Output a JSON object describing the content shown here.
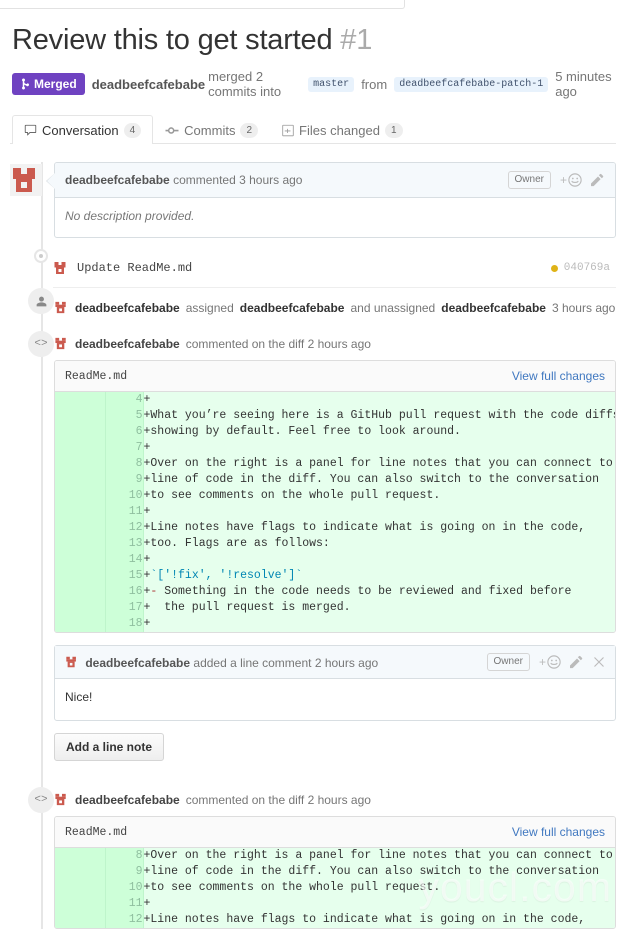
{
  "pull_request": {
    "title": "Review this to get started",
    "number": "#1",
    "state_label": "Merged",
    "meta": {
      "author": "deadbeefcafebabe",
      "merged_text": "merged 2 commits into",
      "base_branch": "master",
      "from_text": "from",
      "head_branch": "deadbeefcafebabe-patch-1",
      "time": "5 minutes ago"
    }
  },
  "tabs": [
    {
      "label": "Conversation",
      "count": "4",
      "icon": "comment-icon",
      "active": true
    },
    {
      "label": "Commits",
      "count": "2",
      "icon": "commit-icon",
      "active": false
    },
    {
      "label": "Files changed",
      "count": "1",
      "icon": "file-diff-icon",
      "active": false
    }
  ],
  "timeline": {
    "main_comment": {
      "author": "deadbeefcafebabe",
      "action": "commented 3 hours ago",
      "owner_badge": "Owner",
      "body": "No description provided."
    },
    "commit": {
      "message": "Update ReadMe.md",
      "sha": "040769a"
    },
    "assign_event": {
      "actor": "deadbeefcafebabe",
      "assigned_text": "assigned",
      "assignee": "deadbeefcafebabe",
      "unassigned_text": "and unassigned",
      "unassignee": "deadbeefcafebabe",
      "time": "3 hours ago"
    },
    "diff_comment_1": {
      "author": "deadbeefcafebabe",
      "action": "commented on the diff 2 hours ago",
      "file": "ReadMe.md",
      "view_full_changes": "View full changes",
      "lines": [
        {
          "num": "4",
          "text": "+"
        },
        {
          "num": "5",
          "text": "+What you’re seeing here is a GitHub pull request with the code diffs"
        },
        {
          "num": "6",
          "text": "+showing by default. Feel free to look around."
        },
        {
          "num": "7",
          "text": "+"
        },
        {
          "num": "8",
          "text": "+Over on the right is a panel for line notes that you can connect to a"
        },
        {
          "num": "9",
          "text": "+line of code in the diff. You can also switch to the conversation"
        },
        {
          "num": "10",
          "text": "+to see comments on the whole pull request."
        },
        {
          "num": "11",
          "text": "+"
        },
        {
          "num": "12",
          "text": "+Line notes have flags to indicate what is going on in the code,"
        },
        {
          "num": "13",
          "text": "+too. Flags are as follows:"
        },
        {
          "num": "14",
          "text": "+"
        },
        {
          "num": "15",
          "text": "+`['!fix', '!resolve']`",
          "highlight": "code"
        },
        {
          "num": "16",
          "text": "+- Something in the code needs to be reviewed and fixed before",
          "highlight": "dash"
        },
        {
          "num": "17",
          "text": "+  the pull request is merged."
        },
        {
          "num": "18",
          "text": "+"
        }
      ],
      "line_comment": {
        "author": "deadbeefcafebabe",
        "action": "added a line comment 2 hours ago",
        "owner_badge": "Owner",
        "body": "Nice!"
      },
      "add_note_button": "Add a line note"
    },
    "diff_comment_2": {
      "author": "deadbeefcafebabe",
      "action": "commented on the diff 2 hours ago",
      "file": "ReadMe.md",
      "view_full_changes": "View full changes",
      "lines": [
        {
          "num": "8",
          "text": "+Over on the right is a panel for line notes that you can connect to a"
        },
        {
          "num": "9",
          "text": "+line of code in the diff. You can also switch to the conversation"
        },
        {
          "num": "10",
          "text": "+to see comments on the whole pull request."
        },
        {
          "num": "11",
          "text": "+"
        },
        {
          "num": "12",
          "text": "+Line notes have flags to indicate what is going on in the code,"
        }
      ]
    }
  },
  "watermark": "youcl.com",
  "colors": {
    "merged_purple": "#6f42c1",
    "link_blue": "#4078c0",
    "diff_add_bg": "#e6ffed",
    "diff_gutter_bg": "#cdffd8",
    "sha_dot": "#dfb317",
    "identicon_red": "#cb5a4e"
  }
}
